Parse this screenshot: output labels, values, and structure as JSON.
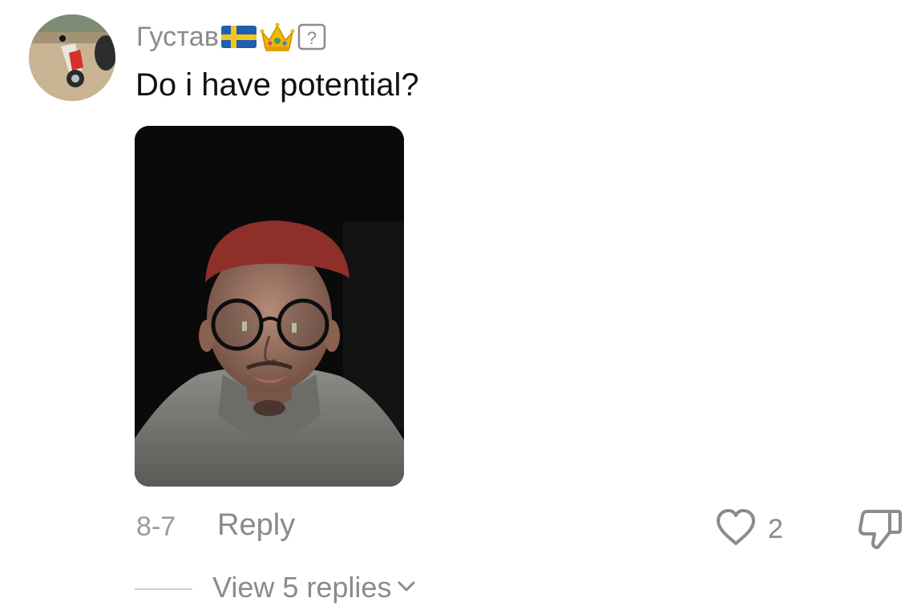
{
  "comment": {
    "username": "Густав",
    "badges": [
      "sweden-flag-emoji",
      "crown-emoji",
      "unknown-glyph-box"
    ],
    "text": "Do i have potential?",
    "date": "8-7",
    "reply_label": "Reply",
    "like_count": "2",
    "view_replies_label": "View 5 replies"
  },
  "icons": {
    "like": "heart-outline-icon",
    "dislike": "thumbs-down-icon",
    "expand": "chevron-down-icon"
  },
  "colors": {
    "username": "#8a8a8f",
    "text": "#111111",
    "secondary": "#8a8a8f",
    "background": "#ffffff"
  }
}
